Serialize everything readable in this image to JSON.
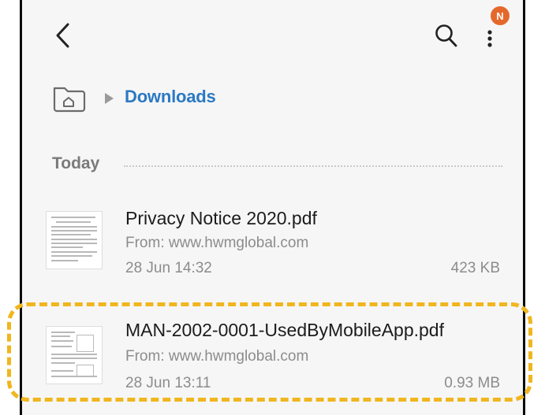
{
  "header": {
    "back_icon": "chevron-left-icon",
    "search_icon": "search-icon",
    "more_icon": "more-vertical-icon",
    "notification_badge": "N",
    "badge_color": "#e5682b"
  },
  "breadcrumb": {
    "home_icon": "home-folder-icon",
    "current": "Downloads",
    "accent": "#2b79c4"
  },
  "section": {
    "title": "Today"
  },
  "files": [
    {
      "name": "Privacy Notice 2020.pdf",
      "source": "From: www.hwmglobal.com",
      "date": "28 Jun 14:32",
      "size": "423 KB",
      "thumbnail_icon": "pdf-thumbnail"
    },
    {
      "name": "MAN-2002-0001-UsedByMobileApp.pdf",
      "source": "From: www.hwmglobal.com",
      "date": "28 Jun 13:11",
      "size": "0.93 MB",
      "thumbnail_icon": "pdf-thumbnail",
      "highlighted": true
    }
  ],
  "highlight_color": "#f0b61f"
}
